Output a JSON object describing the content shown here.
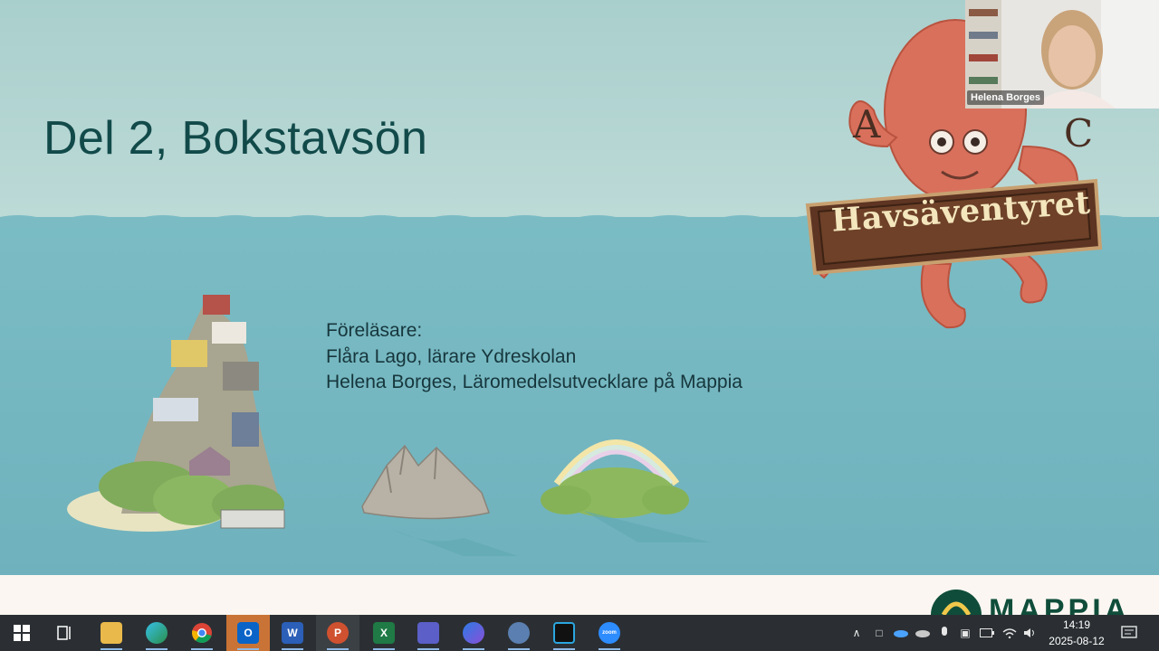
{
  "slide": {
    "title": "Del 2, Bokstavsön",
    "lecturers": [
      "Föreläsare:",
      "Flåra Lago, lärare Ydreskolan",
      "Helena Borges, Läromedelsutvecklare på Mappia"
    ],
    "logo_text": "Havsäventyret",
    "octopus_letters": [
      "A",
      "C"
    ],
    "brand": "MAPPIA"
  },
  "webcam": {
    "participant_name": "Helena Borges"
  },
  "taskbar": {
    "apps": [
      {
        "name": "start",
        "icon": "windows-logo-icon"
      },
      {
        "name": "task-view",
        "icon": "task-view-icon"
      },
      {
        "name": "file-explorer",
        "icon": "folder-icon"
      },
      {
        "name": "edge",
        "icon": "edge-icon"
      },
      {
        "name": "chrome",
        "icon": "chrome-icon"
      },
      {
        "name": "outlook",
        "icon": "outlook-icon"
      },
      {
        "name": "word",
        "icon": "word-icon"
      },
      {
        "name": "powerpoint",
        "icon": "powerpoint-icon"
      },
      {
        "name": "excel",
        "icon": "excel-icon"
      },
      {
        "name": "teams",
        "icon": "teams-icon"
      },
      {
        "name": "copilot",
        "icon": "copilot-icon"
      },
      {
        "name": "snipping",
        "icon": "snipping-icon"
      },
      {
        "name": "webex",
        "icon": "webex-icon"
      },
      {
        "name": "zoom",
        "icon": "zoom-icon"
      }
    ],
    "app_labels": {
      "word": "W",
      "powerpoint": "P",
      "excel": "X",
      "outlook": "O",
      "zoom": "zoom"
    },
    "clock": {
      "time": "14:19",
      "date": "2025-08-12"
    }
  },
  "colors": {
    "title": "#124a4a",
    "sea": "#74b6c0",
    "octopus": "#d9705c",
    "taskbar": "#2b2f33"
  }
}
